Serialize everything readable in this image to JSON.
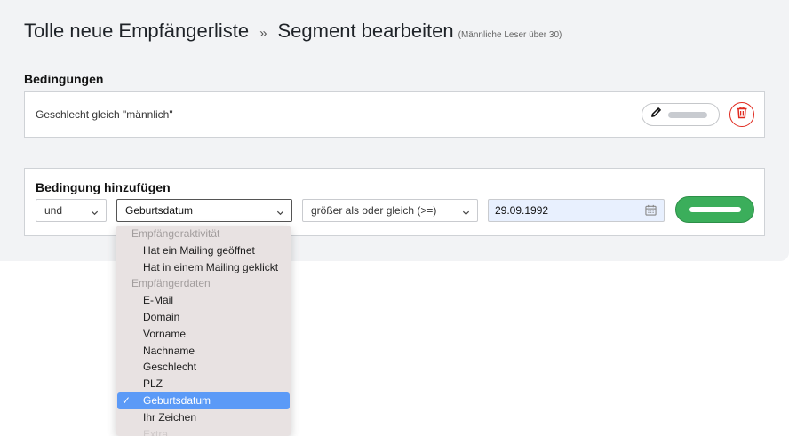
{
  "header": {
    "list_title": "Tolle neue Empfängerliste",
    "separator": "»",
    "page_title": "Segment bearbeiten",
    "subtitle": "(Männliche Leser über 30)"
  },
  "conditions": {
    "label": "Bedingungen",
    "items": [
      {
        "text": "Geschlecht gleich \"männlich\""
      }
    ]
  },
  "add_condition": {
    "label": "Bedingung hinzufügen",
    "conjunction": "und",
    "field": "Geburtsdatum",
    "operator": "größer als oder gleich (>=)",
    "value": "29.09.1992"
  },
  "dropdown": {
    "group_1": "Empfängeraktivität",
    "opt_1": "Hat ein Mailing geöffnet",
    "opt_2": "Hat in einem Mailing geklickt",
    "group_2": "Empfängerdaten",
    "opt_3": "E-Mail",
    "opt_4": "Domain",
    "opt_5": "Vorname",
    "opt_6": "Nachname",
    "opt_7": "Geschlecht",
    "opt_8": "PLZ",
    "opt_9": "Geburtsdatum",
    "opt_10": "Ihr Zeichen",
    "opt_11": "Extra",
    "check": "✓"
  },
  "colors": {
    "save_green": "#3bae5b",
    "delete_red": "#e02a1f",
    "selection_blue": "#5b9af7",
    "date_bg": "#e8f0fe"
  },
  "icons": {
    "edit": "pencil-icon",
    "delete": "trash-icon",
    "select": "chevron-down-icon",
    "date": "calendar-icon"
  }
}
